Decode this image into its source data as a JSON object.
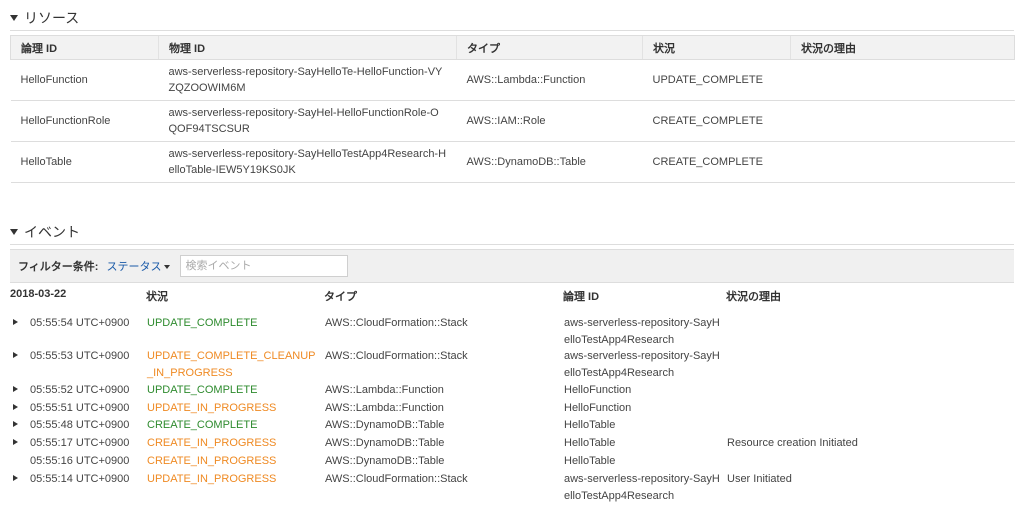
{
  "resources": {
    "title": "リソース",
    "columns": [
      "論理 ID",
      "物理 ID",
      "タイプ",
      "状況",
      "状況の理由"
    ],
    "rows": [
      {
        "logical_id": "HelloFunction",
        "physical_id": "aws-serverless-repository-SayHelloTe-HelloFunction-VYZQZOOWIM6M",
        "physical_link": true,
        "type": "AWS::Lambda::Function",
        "status": "UPDATE_COMPLETE",
        "status_color": "green",
        "reason": ""
      },
      {
        "logical_id": "HelloFunctionRole",
        "physical_id": "aws-serverless-repository-SayHel-HelloFunctionRole-OQOF94TSCSUR",
        "physical_link": true,
        "type": "AWS::IAM::Role",
        "status": "CREATE_COMPLETE",
        "status_color": "green",
        "reason": ""
      },
      {
        "logical_id": "HelloTable",
        "physical_id": "aws-serverless-repository-SayHelloTestApp4Research-HelloTable-IEW5Y19KS0JK",
        "physical_link": false,
        "type": "AWS::DynamoDB::Table",
        "status": "CREATE_COMPLETE",
        "status_color": "green",
        "reason": ""
      }
    ]
  },
  "events": {
    "title": "イベント",
    "filter_label": "フィルター条件:",
    "filter_dropdown": "ステータス",
    "search_placeholder": "検索イベント",
    "columns": {
      "date": "2018-03-22",
      "status": "状況",
      "type": "タイプ",
      "logical_id": "論理 ID",
      "reason": "状況の理由"
    },
    "rows": [
      {
        "expandable": true,
        "time": "05:55:54 UTC+0900",
        "status": "UPDATE_COMPLETE",
        "status_color": "green",
        "type": "AWS::CloudFormation::Stack",
        "logical_id": "aws-serverless-repository-SayHelloTestApp4Research",
        "reason": ""
      },
      {
        "expandable": true,
        "time": "05:55:53 UTC+0900",
        "status": "UPDATE_COMPLETE_CLEANUP_IN_PROGRESS",
        "status_color": "orange",
        "type": "AWS::CloudFormation::Stack",
        "logical_id": "aws-serverless-repository-SayHelloTestApp4Research",
        "reason": ""
      },
      {
        "expandable": true,
        "time": "05:55:52 UTC+0900",
        "status": "UPDATE_COMPLETE",
        "status_color": "green",
        "type": "AWS::Lambda::Function",
        "logical_id": "HelloFunction",
        "reason": ""
      },
      {
        "expandable": true,
        "time": "05:55:51 UTC+0900",
        "status": "UPDATE_IN_PROGRESS",
        "status_color": "orange",
        "type": "AWS::Lambda::Function",
        "logical_id": "HelloFunction",
        "reason": ""
      },
      {
        "expandable": true,
        "time": "05:55:48 UTC+0900",
        "status": "CREATE_COMPLETE",
        "status_color": "green",
        "type": "AWS::DynamoDB::Table",
        "logical_id": "HelloTable",
        "reason": ""
      },
      {
        "expandable": true,
        "time": "05:55:17 UTC+0900",
        "status": "CREATE_IN_PROGRESS",
        "status_color": "orange",
        "type": "AWS::DynamoDB::Table",
        "logical_id": "HelloTable",
        "reason": "Resource creation Initiated"
      },
      {
        "expandable": false,
        "time": "05:55:16 UTC+0900",
        "status": "CREATE_IN_PROGRESS",
        "status_color": "orange",
        "type": "AWS::DynamoDB::Table",
        "logical_id": "HelloTable",
        "reason": ""
      },
      {
        "expandable": true,
        "time": "05:55:14 UTC+0900",
        "status": "UPDATE_IN_PROGRESS",
        "status_color": "orange",
        "type": "AWS::CloudFormation::Stack",
        "logical_id": "aws-serverless-repository-SayHelloTestApp4Research",
        "reason": "User Initiated"
      }
    ]
  }
}
